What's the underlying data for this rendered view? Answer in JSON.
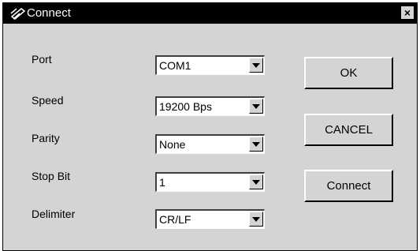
{
  "window": {
    "title": "Connect",
    "close_label": "×"
  },
  "fields": [
    {
      "label": "Port",
      "value": "COM1"
    },
    {
      "label": "Speed",
      "value": "19200 Bps"
    },
    {
      "label": "Parity",
      "value": "None"
    },
    {
      "label": "Stop Bit",
      "value": "1"
    },
    {
      "label": "Delimiter",
      "value": "CR/LF"
    }
  ],
  "buttons": {
    "ok": "OK",
    "cancel": "CANCEL",
    "connect": "Connect"
  },
  "icons": {
    "title": "connect-icon",
    "close": "close-icon",
    "dropdown": "chevron-down-icon"
  },
  "colors": {
    "titlebar": "#000000",
    "panel": "#d4d4d4",
    "field": "#ffffff"
  }
}
